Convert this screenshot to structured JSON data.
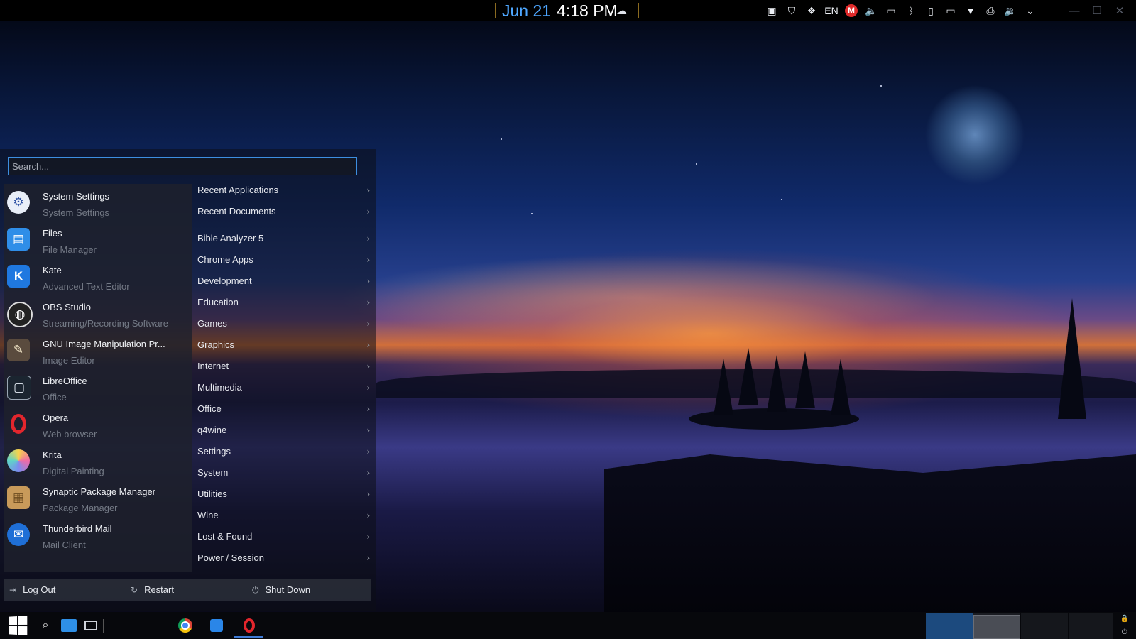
{
  "top_panel": {
    "date": "Jun 21",
    "time": "4:18 PM",
    "weather_icon": "cloud-snow-icon",
    "language": "EN",
    "tray_icons": [
      "chat-icon",
      "shield-icon",
      "dropbox-icon",
      "language-indicator",
      "mega-icon",
      "volume-icon",
      "battery-icon",
      "bluetooth-icon",
      "usb-icon",
      "display-icon",
      "wifi-icon",
      "printer-icon",
      "volume-icon",
      "chevron-down-icon"
    ],
    "mega_label": "M"
  },
  "search": {
    "placeholder": "Search..."
  },
  "favorites": [
    {
      "name": "System Settings",
      "description": "System Settings",
      "icon": "settings-gear-icon"
    },
    {
      "name": "Files",
      "description": "File Manager",
      "icon": "files-icon"
    },
    {
      "name": "Kate",
      "description": "Advanced Text Editor",
      "icon": "kate-icon"
    },
    {
      "name": "OBS Studio",
      "description": "Streaming/Recording Software",
      "icon": "obs-icon"
    },
    {
      "name": "GNU Image Manipulation Pr...",
      "description": "Image Editor",
      "icon": "gimp-icon"
    },
    {
      "name": "LibreOffice",
      "description": "Office",
      "icon": "libreoffice-icon"
    },
    {
      "name": "Opera",
      "description": "Web browser",
      "icon": "opera-icon"
    },
    {
      "name": "Krita",
      "description": "Digital Painting",
      "icon": "krita-icon"
    },
    {
      "name": "Synaptic Package Manager",
      "description": "Package Manager",
      "icon": "package-icon"
    },
    {
      "name": "Thunderbird Mail",
      "description": "Mail Client",
      "icon": "thunderbird-icon"
    }
  ],
  "categories": [
    "Recent Applications",
    "Recent Documents",
    "Bible Analyzer 5",
    "Chrome Apps",
    "Development",
    "Education",
    "Games",
    "Graphics",
    "Internet",
    "Multimedia",
    "Office",
    "q4wine",
    "Settings",
    "System",
    "Utilities",
    "Wine",
    "Lost & Found",
    "Power / Session"
  ],
  "power": {
    "logout": "Log Out",
    "restart": "Restart",
    "shutdown": "Shut Down"
  },
  "taskbar": {
    "items": [
      "windows-start-icon",
      "search-icon",
      "file-manager-icon",
      "task-view-icon",
      "chrome-icon",
      "kate-icon",
      "opera-icon"
    ]
  },
  "colors": {
    "accent": "#3d8ee0",
    "date_color": "#4ea7ff",
    "menu_bg": "#1e212c"
  }
}
